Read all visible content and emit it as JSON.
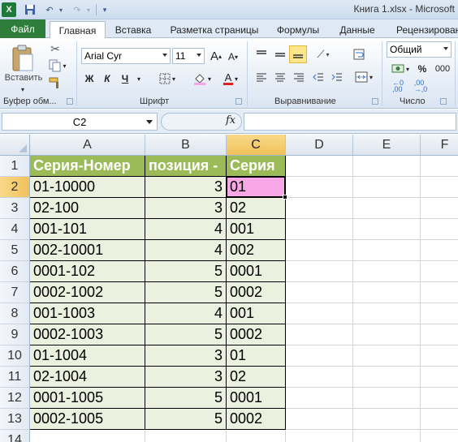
{
  "window": {
    "title": "Книга 1.xlsx - Microsoft"
  },
  "ribbon": {
    "tabs": [
      "Файл",
      "Главная",
      "Вставка",
      "Разметка страницы",
      "Формулы",
      "Данные",
      "Рецензирован"
    ],
    "active_tab": "Главная",
    "clipboard": {
      "paste_label": "Вставить",
      "group_label": "Буфер обм..."
    },
    "font": {
      "name": "Arial Cyr",
      "size": "11",
      "bold": "Ж",
      "italic": "К",
      "underline": "Ч",
      "grow": "A",
      "shrink": "A",
      "color_letter": "A",
      "group_label": "Шрифт"
    },
    "alignment": {
      "group_label": "Выравнивание"
    },
    "number": {
      "format": "Общий",
      "percent": "%",
      "thousands": "000",
      "group_label": "Число"
    }
  },
  "formula_bar": {
    "name_box": "C2",
    "fx": "fx",
    "formula": ""
  },
  "sheet": {
    "columns": [
      "A",
      "B",
      "C",
      "D",
      "E",
      "F"
    ],
    "selected_cell": "C2",
    "rows": [
      {
        "n": "1",
        "a": "Серия-Номер",
        "b": "позиция -",
        "c": "Серия"
      },
      {
        "n": "2",
        "a": "01-10000",
        "b": "3",
        "c": "01"
      },
      {
        "n": "3",
        "a": "02-100",
        "b": "3",
        "c": "02"
      },
      {
        "n": "4",
        "a": "001-101",
        "b": "4",
        "c": "001"
      },
      {
        "n": "5",
        "a": "002-10001",
        "b": "4",
        "c": "002"
      },
      {
        "n": "6",
        "a": "0001-102",
        "b": "5",
        "c": "0001"
      },
      {
        "n": "7",
        "a": "0002-1002",
        "b": "5",
        "c": "0002"
      },
      {
        "n": "8",
        "a": "001-1003",
        "b": "4",
        "c": "001"
      },
      {
        "n": "9",
        "a": "0002-1003",
        "b": "5",
        "c": "0002"
      },
      {
        "n": "10",
        "a": "01-1004",
        "b": "3",
        "c": "01"
      },
      {
        "n": "11",
        "a": "02-1004",
        "b": "3",
        "c": "02"
      },
      {
        "n": "12",
        "a": "0001-1005",
        "b": "5",
        "c": "0001"
      },
      {
        "n": "13",
        "a": "0002-1005",
        "b": "5",
        "c": "0002"
      },
      {
        "n": "14",
        "a": "",
        "b": "",
        "c": ""
      }
    ]
  },
  "colors": {
    "header_fill": "#9bbb59",
    "data_fill": "#ebf1de",
    "active_cell_fill": "#f7a6e6",
    "file_tab": "#2e7d3a"
  }
}
